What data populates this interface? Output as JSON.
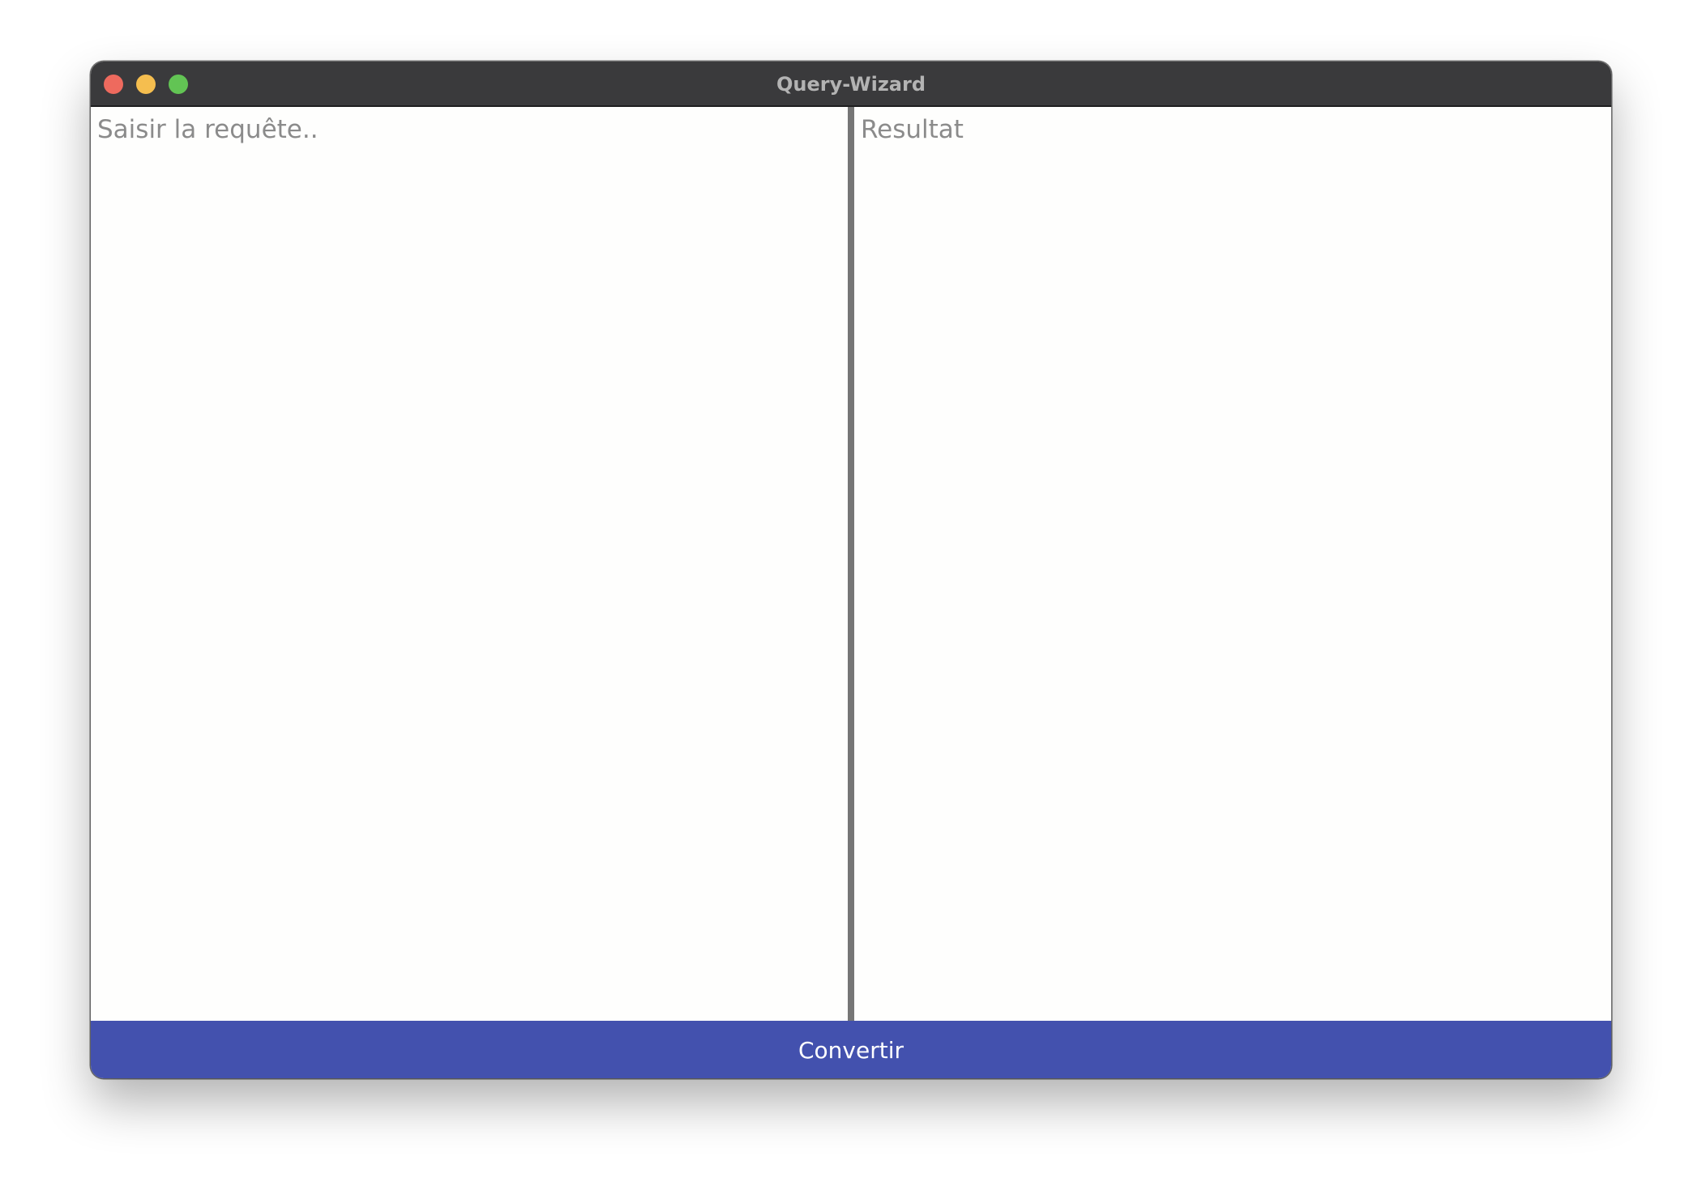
{
  "window": {
    "title": "Query-Wizard",
    "controls": [
      "close",
      "minimize",
      "zoom"
    ]
  },
  "editor": {
    "input_placeholder": "Saisir la requête..",
    "output_placeholder": "Resultat"
  },
  "actions": {
    "convert_label": "Convertir"
  },
  "colors": {
    "titlebar": "#3a3a3c",
    "close": "#ee6a5e",
    "minimize": "#f5be4f",
    "zoom": "#62c454",
    "splitter": "#767676",
    "accent": "#4351ae"
  }
}
